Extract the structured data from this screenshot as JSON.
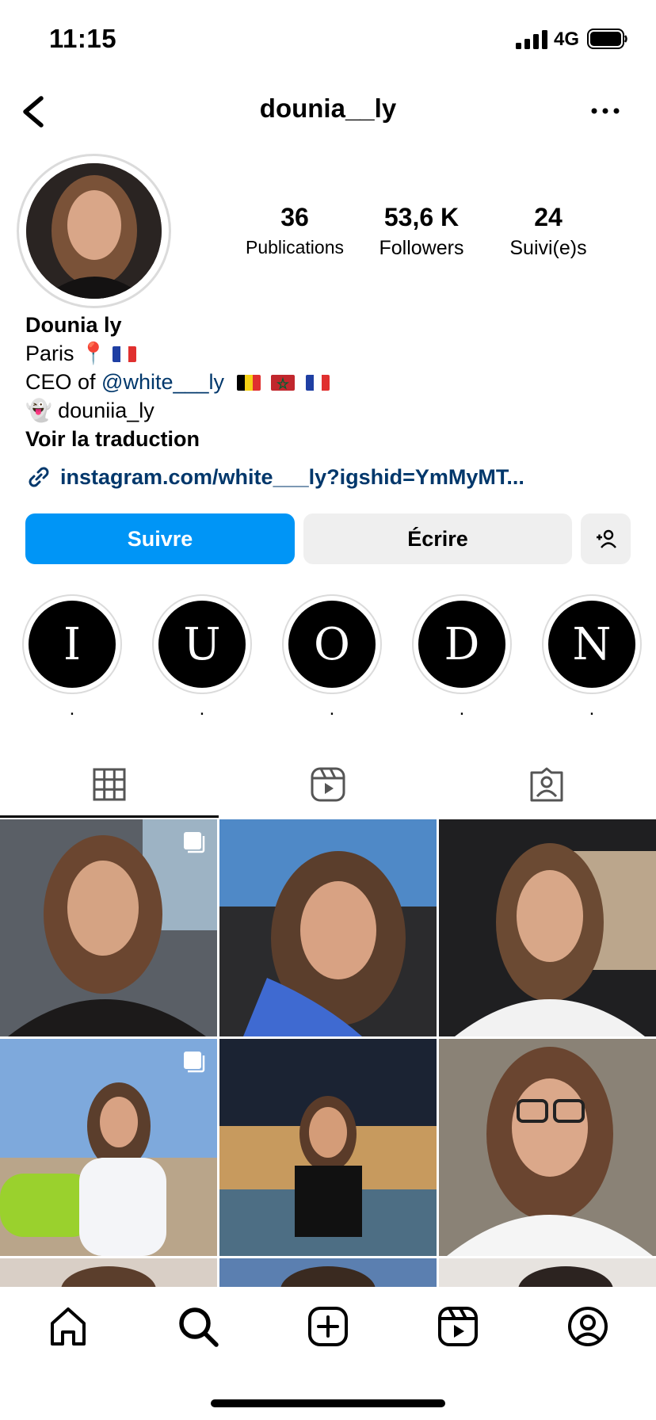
{
  "status_bar": {
    "time": "11:15",
    "network": "4G"
  },
  "header": {
    "username": "dounia__ly"
  },
  "stats": [
    {
      "value": "36",
      "label": "Publications"
    },
    {
      "value": "53,6 K",
      "label": "Followers"
    },
    {
      "value": "24",
      "label": "Suivi(e)s"
    }
  ],
  "bio": {
    "name": "Dounia ly",
    "location": "Paris",
    "ceo_prefix": "CEO of",
    "mention": "@white___ly",
    "snapchat": "douniia_ly",
    "translate": "Voir la traduction",
    "link": "instagram.com/white___ly?igshid=YmMyMT..."
  },
  "buttons": {
    "follow": "Suivre",
    "message": "Écrire"
  },
  "highlights": [
    {
      "letter": "I",
      "label": "."
    },
    {
      "letter": "U",
      "label": "."
    },
    {
      "letter": "O",
      "label": "."
    },
    {
      "letter": "D",
      "label": "."
    },
    {
      "letter": "N",
      "label": "."
    }
  ],
  "colors": {
    "follow_button": "#0095f6",
    "secondary_button": "#efefef",
    "link": "#00376b"
  },
  "icons": {
    "tabs": [
      "grid-icon",
      "reels-icon",
      "tagged-icon"
    ],
    "nav": [
      "home-icon",
      "search-icon",
      "create-icon",
      "reels-icon",
      "profile-icon"
    ]
  }
}
